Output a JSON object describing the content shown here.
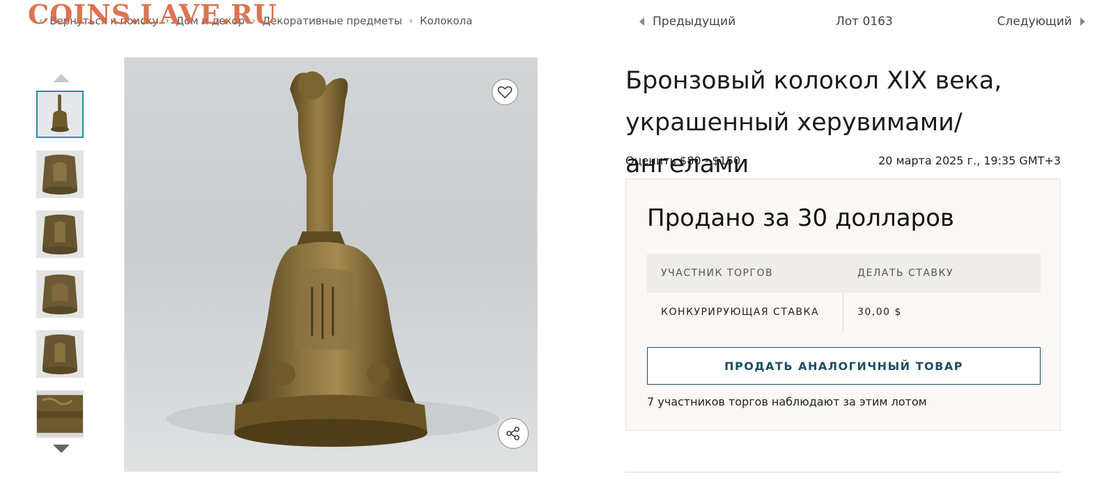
{
  "watermark": "COINS.LAVE.RU",
  "breadcrumb": {
    "back": "Вернуться к поиску",
    "items": [
      "Дом и декор",
      "Декоративные предметы",
      "Колокола"
    ]
  },
  "lot_nav": {
    "prev": "Предыдущий",
    "lot": "Лот 0163",
    "next": "Следующий"
  },
  "title_lines": [
    "Бронзовый колокол XIX века,",
    "украшенный херувимами/ангелами"
  ],
  "estimate": "Оценить $80 - $150",
  "datetime": "20 марта 2025 г., 19:35 GMT+3",
  "panel": {
    "sold": "Продано за 30 долларов",
    "table": {
      "headers": [
        "УЧАСТНИК ТОРГОВ",
        "ДЕЛАТЬ СТАВКУ"
      ],
      "row": [
        "КОНКУРИРУЮЩАЯ СТАВКА",
        "30,00 $"
      ]
    },
    "sell_button": "ПРОДАТЬ АНАЛОГИЧНЫЙ ТОВАР",
    "watchers": "7 участников торгов наблюдают за этим лотом"
  },
  "icons": {
    "favorite": "heart-icon",
    "share": "share-icon",
    "thumb_up": "caret-up-icon",
    "thumb_down": "caret-down-icon"
  },
  "colors": {
    "accent": "#1d4e63",
    "active_thumb_border": "#2a8aa8",
    "panel_bg": "#fbf8f5",
    "watermark": "#d9663f",
    "bronze": "#7a6230"
  }
}
